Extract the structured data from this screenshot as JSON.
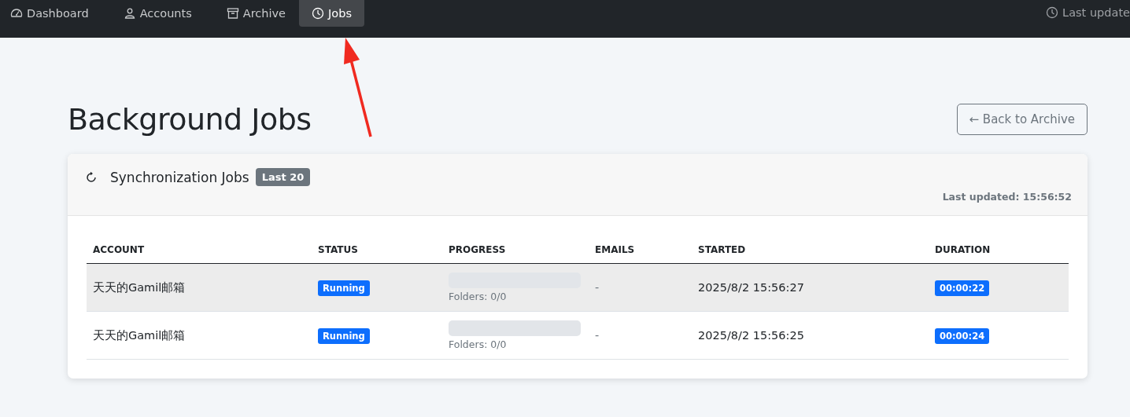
{
  "nav": {
    "items": [
      {
        "label": "Dashboard",
        "kind": "gauge",
        "selected": false
      },
      {
        "label": "Accounts",
        "kind": "person",
        "selected": false
      },
      {
        "label": "Archive",
        "kind": "archive",
        "selected": false
      },
      {
        "label": "Jobs",
        "kind": "clock",
        "selected": true
      }
    ],
    "status": "Last update"
  },
  "page": {
    "title": "Background Jobs",
    "back_button": "← Back to Archive"
  },
  "card": {
    "title": "Synchronization Jobs",
    "badge": "Last 20",
    "last_updated": "Last updated: 15:56:52",
    "table": {
      "columns": [
        "ACCOUNT",
        "STATUS",
        "PROGRESS",
        "EMAILS",
        "STARTED",
        "DURATION"
      ],
      "rows": [
        {
          "account": "天天的Gamil邮箱",
          "status": "Running",
          "level": 0,
          "progress_text": "Folders: 0/0",
          "emails": "-",
          "started": "2025/8/2 15:56:27",
          "duration": "00:00:22",
          "highlighted": true
        },
        {
          "account": "天天的Gamil邮箱",
          "status": "Running",
          "level": 0,
          "progress_text": "Folders: 0/0",
          "emails": "-",
          "started": "2025/8/2 15:56:25",
          "duration": "00:00:24",
          "highlighted": false
        }
      ]
    }
  },
  "annotation": {
    "kind": "arrow"
  }
}
